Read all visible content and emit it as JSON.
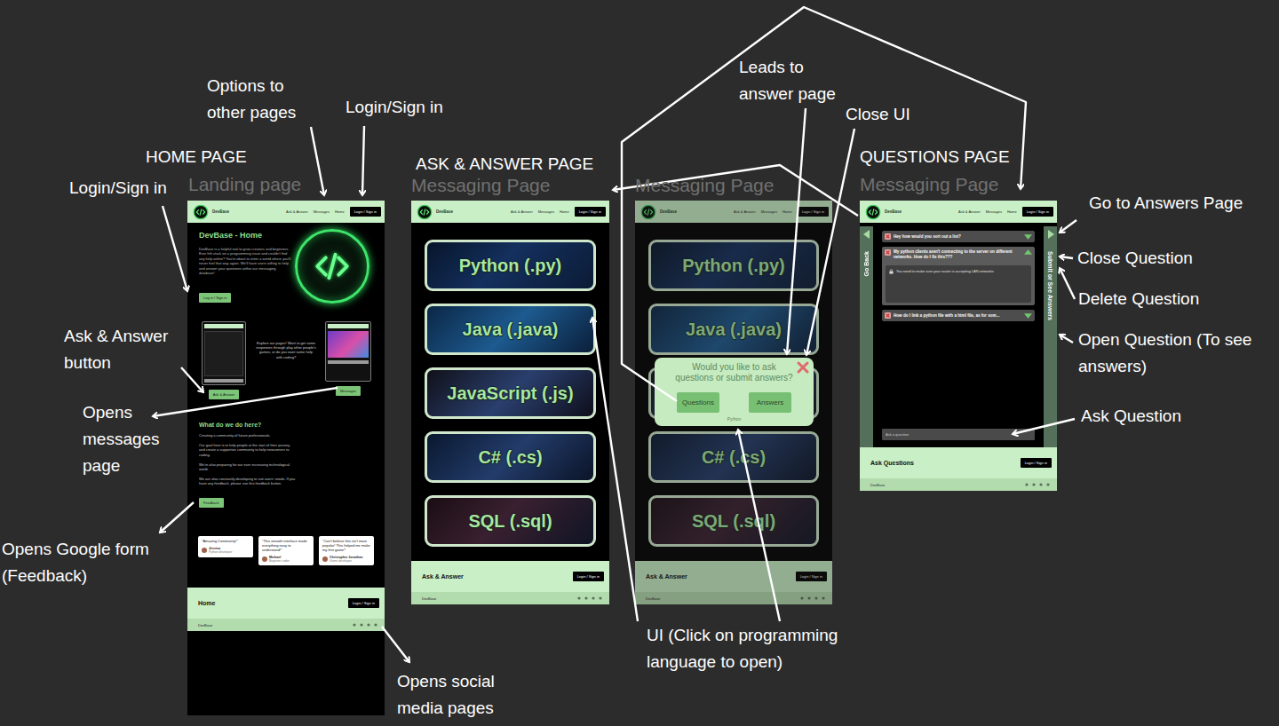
{
  "nav": {
    "brand": "DevBase",
    "links": [
      "Ask & Answer",
      "Messages",
      "Home"
    ],
    "login": "Login / Sign in"
  },
  "footer_brand": "DevBase",
  "home_page": {
    "caption": "HOME PAGE",
    "subtitle": "Landing page",
    "title": "DevBase - Home",
    "intro": "DevBase is a helpful tool to grow creators and beginners. Ever felt stuck on a programming issue and couldn't find any help online? You're about to enter a world where you'll never feel that way again. We'll have users willing to help and answer your questions within our messaging database!",
    "login_button": "Log in / Sign in",
    "explore_text": "Explore our pages! Want to get some responses through play other people's games, or do you want some help with coding?",
    "ask_button": "Ask & Answer",
    "messages_button": "Messages",
    "section_title": "What do we do here?",
    "paragraphs": [
      "Creating a community of future professionals.",
      "Our goal here is to help people at the start of their journey and create a supportive community to help newcomers to coding.",
      "We're also preparing for our ever increasing technological world.",
      "We are also constantly developing to suit users' needs. If you have any feedback, please use this feedback button."
    ],
    "feedback_button": "Feedback",
    "testimonials": [
      {
        "quote": "\"Amazing Community!\"",
        "name": "Jessica",
        "role": "Python developer"
      },
      {
        "quote": "\"This smooth interface made everything easy to understand!\"",
        "name": "Michael",
        "role": "Beginner coder"
      },
      {
        "quote": "\"Can't believe this isn't more popular! This helped me make my first game!\"",
        "name": "Christopher Jonathan",
        "role": "Game developer"
      }
    ],
    "footer_title": "Home",
    "footer_button": "Login / Sign in"
  },
  "ask_answer_page": {
    "caption": "ASK & ANSWER PAGE",
    "subtitle": "Messaging Page",
    "languages": [
      "Python (.py)",
      "Java (.java)",
      "JavaScript (.js)",
      "C# (.cs)",
      "SQL (.sql)"
    ],
    "footer_title": "Ask & Answer",
    "footer_button": "Login / Sign in"
  },
  "popup_page": {
    "subtitle": "Messaging Page",
    "languages": [
      "Python (.py)",
      "Java (.java)",
      "",
      "C# (.cs)",
      "SQL (.sql)"
    ],
    "popup": {
      "prompt": "Would you like to ask questions or submit answers?",
      "buttons": [
        "Questions",
        "Answers"
      ],
      "language": "Python"
    },
    "footer_title": "Ask & Answer",
    "footer_button": "Login / Sign in"
  },
  "questions_page": {
    "caption": "QUESTIONS PAGE",
    "subtitle": "Messaging Page",
    "back_label": "Go Back",
    "forward_label": "Submit or See Answers",
    "questions": [
      {
        "text": "Hey how would you sort out a list?",
        "expanded": false,
        "answers": []
      },
      {
        "text": "My python clients aren't connecting to the server on different networks. How do I fix this???",
        "expanded": true,
        "answers": [
          "You need to make sure your router is accepting LAN networks"
        ]
      },
      {
        "text": "How do I link a python file with a html file, as for som...",
        "expanded": false,
        "answers": []
      }
    ],
    "input_placeholder": "Ask a question",
    "footer_title": "Ask Questions",
    "footer_button": "Login / Sign in"
  },
  "annotations": [
    "Options to other pages",
    "Login/Sign in",
    "Login/Sign in",
    "Ask & Answer button",
    "Opens messages page",
    "Opens Google form (Feedback)",
    "Opens social media pages",
    "Leads to answer page",
    "Close UI",
    "Go to Answers Page",
    "Close Question",
    "Delete Question",
    "Open Question (To see answers)",
    "Ask Question",
    "UI (Click on programming language to open)"
  ]
}
